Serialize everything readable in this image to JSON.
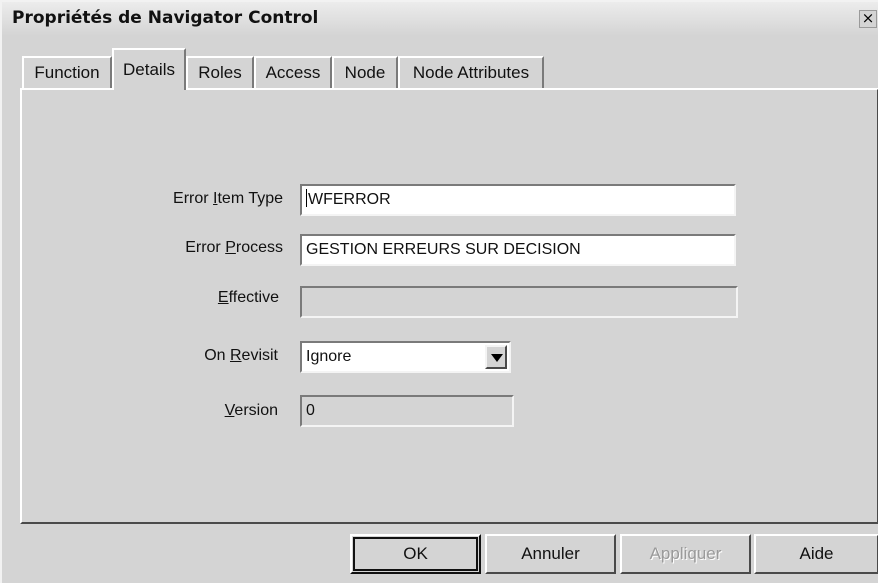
{
  "window": {
    "title": "Propriétés de Navigator Control",
    "close_label": "×"
  },
  "tabs": [
    {
      "label": "Function",
      "active": false
    },
    {
      "label": "Details",
      "active": true
    },
    {
      "label": "Roles",
      "active": false
    },
    {
      "label": "Access",
      "active": false
    },
    {
      "label": "Node",
      "active": false
    },
    {
      "label": "Node Attributes",
      "active": false
    }
  ],
  "form": {
    "error_item_type": {
      "label_pre": "Error ",
      "label_mnemonic": "I",
      "label_post": "tem Type",
      "value": "WFERROR"
    },
    "error_process": {
      "label_pre": "Error ",
      "label_mnemonic": "P",
      "label_post": "rocess",
      "value": "GESTION ERREURS SUR DECISION"
    },
    "effective": {
      "label_pre": "",
      "label_mnemonic": "E",
      "label_post": "ffective",
      "value": ""
    },
    "on_revisit": {
      "label_pre": "On ",
      "label_mnemonic": "R",
      "label_post": "evisit",
      "value": "Ignore"
    },
    "version": {
      "label_pre": "",
      "label_mnemonic": "V",
      "label_post": "ersion",
      "value": "0"
    }
  },
  "buttons": {
    "ok": "OK",
    "cancel": "Annuler",
    "apply": "Appliquer",
    "help": "Aide"
  }
}
